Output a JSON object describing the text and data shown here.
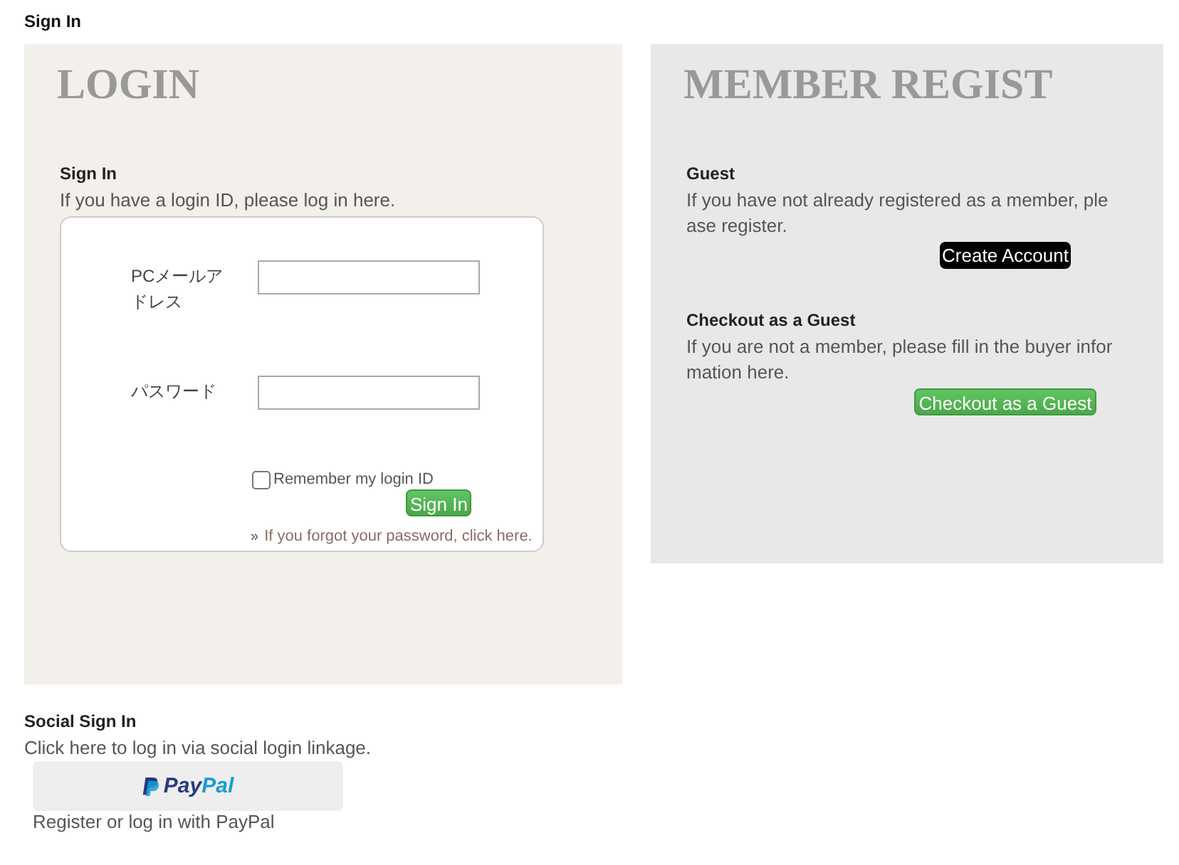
{
  "page_title": "Sign In",
  "login_panel": {
    "heading": "LOGIN",
    "subheading": "Sign In",
    "description": "If you have a login ID, please log in here.",
    "form": {
      "fields": [
        {
          "label": "PCメールアドレス"
        },
        {
          "label": "パスワード"
        }
      ],
      "remember": {
        "label": "Remember my login ID",
        "checked": false
      },
      "submit": "Sign In",
      "forgot": {
        "marker": "»",
        "link": "If you forgot your password, click here."
      }
    }
  },
  "register_panel": {
    "heading": "MEMBER REGIST",
    "sections": [
      {
        "title": "Guest",
        "description": "If you have not already registered as a member, please register.",
        "button": {
          "label": "Create Account",
          "kind": "dark"
        }
      },
      {
        "title": "Checkout as a Guest",
        "description": "If you are not a member, please fill in the buyer information here.",
        "button": {
          "label": "Checkout as a Guest",
          "kind": "green"
        }
      }
    ]
  },
  "social": {
    "title": "Social Sign In",
    "description": "Click here to log in via social login linkage.",
    "paypal_button": {
      "logo": [
        {
          "text": "Pay",
          "color": "#253b80"
        },
        {
          "text": "Pal",
          "color": "#179bd7"
        }
      ]
    },
    "caption": "Register or log in with PayPal"
  }
}
